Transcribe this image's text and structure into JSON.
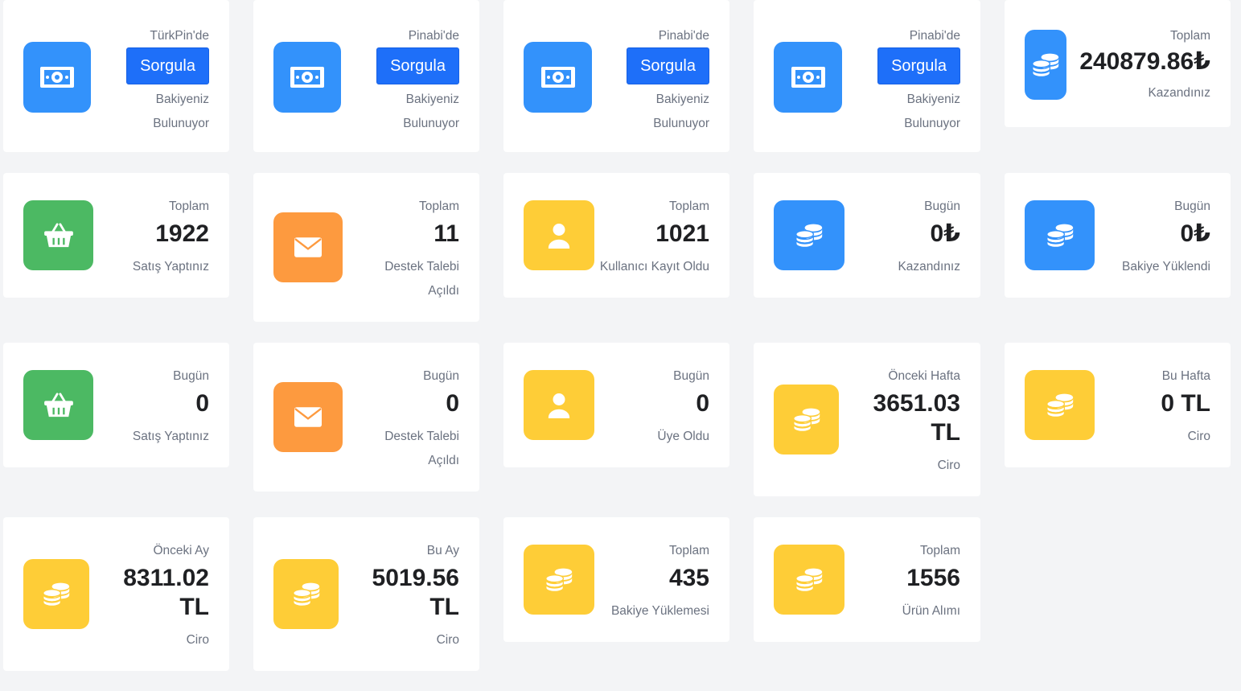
{
  "row1": [
    {
      "label": "TürkPin'de",
      "button": "Sorgula",
      "sub1": "Bakiyeniz",
      "sub2": "Bulunuyor"
    },
    {
      "label": "Pinabi'de",
      "button": "Sorgula",
      "sub1": "Bakiyeniz",
      "sub2": "Bulunuyor"
    },
    {
      "label": "Pinabi'de",
      "button": "Sorgula",
      "sub1": "Bakiyeniz",
      "sub2": "Bulunuyor"
    },
    {
      "label": "Pinabi'de",
      "button": "Sorgula",
      "sub1": "Bakiyeniz",
      "sub2": "Bulunuyor"
    },
    {
      "label": "Toplam",
      "value": "240879.86₺",
      "sub1": "Kazandınız"
    }
  ],
  "row2": [
    {
      "label": "Toplam",
      "value": "1922",
      "sub1": "Satış Yaptınız"
    },
    {
      "label": "Toplam",
      "value": "11",
      "sub1": "Destek Talebi",
      "sub2": "Açıldı"
    },
    {
      "label": "Toplam",
      "value": "1021",
      "sub1": "Kullanıcı Kayıt Oldu"
    },
    {
      "label": "Bugün",
      "value": "0₺",
      "sub1": "Kazandınız"
    },
    {
      "label": "Bugün",
      "value": "0₺",
      "sub1": "Bakiye Yüklendi"
    }
  ],
  "row3": [
    {
      "label": "Bugün",
      "value": "0",
      "sub1": "Satış Yaptınız"
    },
    {
      "label": "Bugün",
      "value": "0",
      "sub1": "Destek Talebi",
      "sub2": "Açıldı"
    },
    {
      "label": "Bugün",
      "value": "0",
      "sub1": "Üye Oldu"
    },
    {
      "label": "Önceki Hafta",
      "value1": "3651.03",
      "value2": "TL",
      "sub1": "Ciro"
    },
    {
      "label": "Bu Hafta",
      "value": "0 TL",
      "sub1": "Ciro"
    }
  ],
  "row4": [
    {
      "label": "Önceki Ay",
      "value1": "8311.02",
      "value2": "TL",
      "sub1": "Ciro"
    },
    {
      "label": "Bu Ay",
      "value1": "5019.56",
      "value2": "TL",
      "sub1": "Ciro"
    },
    {
      "label": "Toplam",
      "value": "435",
      "sub1": "Bakiye Yüklemesi"
    },
    {
      "label": "Toplam",
      "value": "1556",
      "sub1": "Ürün Alımı"
    }
  ],
  "colors": {
    "blue": "#3392fb",
    "green": "#4cb963",
    "orange": "#fd9a3f",
    "yellow": "#fecd37",
    "button": "#1e6ff9",
    "background": "#f3f4f6"
  },
  "icons": [
    "money-icon",
    "coins-icon",
    "basket-icon",
    "envelope-icon",
    "user-icon"
  ]
}
